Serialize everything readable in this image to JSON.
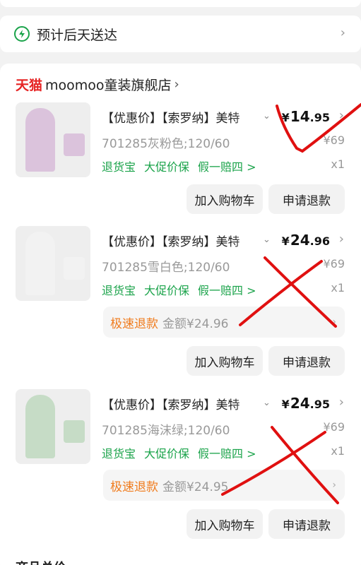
{
  "delivery": {
    "text": "预计后天送达"
  },
  "store": {
    "brand": "天猫",
    "name": "moomoo童装旗舰店"
  },
  "items": [
    {
      "title": "【优惠价】【索罗纳】美特",
      "price_yen": "¥",
      "price_int": "14",
      "price_dec": ".95",
      "orig_price": "¥69",
      "sku": "701285灰粉色;120/60",
      "tags": [
        "退货宝",
        "大促价保",
        "假一赔四 >"
      ],
      "qty": "x1",
      "fast_refund": null,
      "btn_cart": "加入购物车",
      "btn_refund": "申请退款",
      "shirt_color": "#dbc3dc"
    },
    {
      "title": "【优惠价】【索罗纳】美特",
      "price_yen": "¥",
      "price_int": "24",
      "price_dec": ".96",
      "orig_price": "¥69",
      "sku": "701285雪白色;120/60",
      "tags": [
        "退货宝",
        "大促价保",
        "假一赔四 >"
      ],
      "qty": "x1",
      "fast_refund": {
        "label": "极速退款",
        "amount": "金额¥24.96"
      },
      "btn_cart": "加入购物车",
      "btn_refund": "申请退款",
      "shirt_color": "#f2f2f2"
    },
    {
      "title": "【优惠价】【索罗纳】美特",
      "price_yen": "¥",
      "price_int": "24",
      "price_dec": ".95",
      "orig_price": "¥69",
      "sku": "701285海沫绿;120/60",
      "tags": [
        "退货宝",
        "大促价保",
        "假一赔四 >"
      ],
      "qty": "x1",
      "fast_refund": {
        "label": "极速退款",
        "amount": "金额¥24.95"
      },
      "btn_cart": "加入购物车",
      "btn_refund": "申请退款",
      "shirt_color": "#c6dcc6"
    }
  ],
  "colors": {
    "accent_green": "#1aa34a",
    "brand_red": "#e62323",
    "fast_orange": "#f07c1e",
    "annotation_red": "#e01010"
  },
  "footer_partial": "商品总价"
}
